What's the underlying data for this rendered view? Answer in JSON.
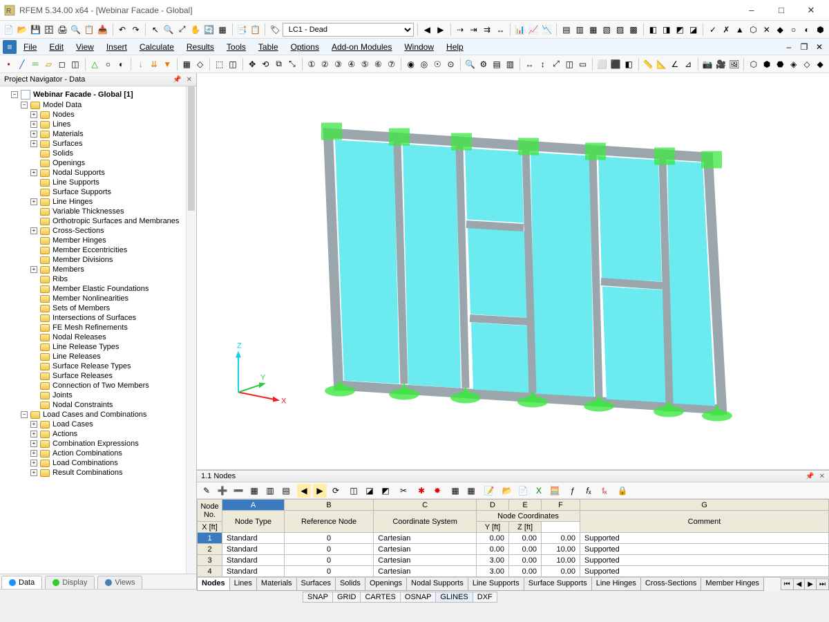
{
  "title": "RFEM 5.34.00 x64 - [Webinar Facade - Global]",
  "load_combo": "LC1 - Dead",
  "menu": [
    "File",
    "Edit",
    "View",
    "Insert",
    "Calculate",
    "Results",
    "Tools",
    "Table",
    "Options",
    "Add-on Modules",
    "Window",
    "Help"
  ],
  "nav_panel_title": "Project Navigator - Data",
  "tree_root": "Webinar Facade - Global [1]",
  "tree_group1": "Model Data",
  "tree_items1": [
    "Nodes",
    "Lines",
    "Materials",
    "Surfaces",
    "Solids",
    "Openings",
    "Nodal Supports",
    "Line Supports",
    "Surface Supports",
    "Line Hinges",
    "Variable Thicknesses",
    "Orthotropic Surfaces and Membranes",
    "Cross-Sections",
    "Member Hinges",
    "Member Eccentricities",
    "Member Divisions",
    "Members",
    "Ribs",
    "Member Elastic Foundations",
    "Member Nonlinearities",
    "Sets of Members",
    "Intersections of Surfaces",
    "FE Mesh Refinements",
    "Nodal Releases",
    "Line Release Types",
    "Line Releases",
    "Surface Release Types",
    "Surface Releases",
    "Connection of Two Members",
    "Joints",
    "Nodal Constraints"
  ],
  "tree_group2": "Load Cases and Combinations",
  "tree_items2": [
    "Load Cases",
    "Actions",
    "Combination Expressions",
    "Action Combinations",
    "Load Combinations",
    "Result Combinations"
  ],
  "nav_tabs": [
    "Data",
    "Display",
    "Views"
  ],
  "table_panel_title": "1.1 Nodes",
  "table_cols_letters": [
    "A",
    "B",
    "C",
    "D",
    "E",
    "F",
    "G"
  ],
  "table_head_rowno": "Node No.",
  "table_head_A": "Node Type",
  "table_head_B": "Reference Node",
  "table_head_C": "Coordinate System",
  "table_head_group": "Node Coordinates",
  "table_head_D": "X [ft]",
  "table_head_E": "Y [ft]",
  "table_head_F": "Z [ft]",
  "table_head_G": "Comment",
  "rows": [
    {
      "no": "1",
      "type": "Standard",
      "ref": "0",
      "sys": "Cartesian",
      "x": "0.00",
      "y": "0.00",
      "z": "0.00",
      "c": "Supported"
    },
    {
      "no": "2",
      "type": "Standard",
      "ref": "0",
      "sys": "Cartesian",
      "x": "0.00",
      "y": "0.00",
      "z": "10.00",
      "c": "Supported"
    },
    {
      "no": "3",
      "type": "Standard",
      "ref": "0",
      "sys": "Cartesian",
      "x": "3.00",
      "y": "0.00",
      "z": "10.00",
      "c": "Supported"
    },
    {
      "no": "4",
      "type": "Standard",
      "ref": "0",
      "sys": "Cartesian",
      "x": "3.00",
      "y": "0.00",
      "z": "0.00",
      "c": "Supported"
    }
  ],
  "bottom_tabs": [
    "Nodes",
    "Lines",
    "Materials",
    "Surfaces",
    "Solids",
    "Openings",
    "Nodal Supports",
    "Line Supports",
    "Surface Supports",
    "Line Hinges",
    "Cross-Sections",
    "Member Hinges"
  ],
  "status": [
    "SNAP",
    "GRID",
    "CARTES",
    "OSNAP",
    "GLINES",
    "DXF"
  ]
}
